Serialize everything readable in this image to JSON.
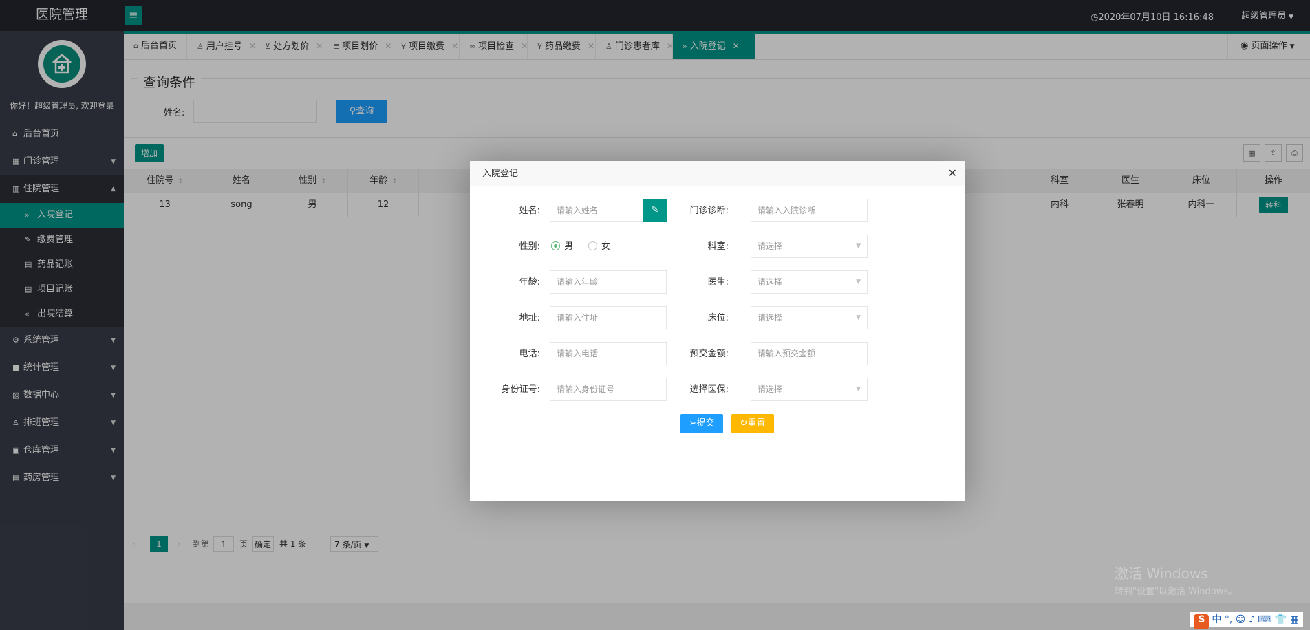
{
  "app": {
    "title": "医院管理",
    "menu_toggle_icon": "≡",
    "datetime": "2020年07月10日 16:16:48",
    "user": "超级管理员"
  },
  "sidebar": {
    "welcome": "你好！超级管理员, 欢迎登录",
    "items_top": [
      {
        "icon": "home-icon",
        "label": "后台首页"
      },
      {
        "icon": "grid-icon",
        "label": "门诊管理"
      },
      {
        "icon": "building-icon",
        "label": "住院管理"
      }
    ],
    "sub_items": [
      {
        "icon": "double-chevron-right-icon",
        "label": "入院登记",
        "active": true
      },
      {
        "icon": "edit-doc-icon",
        "label": "缴费管理"
      },
      {
        "icon": "book-icon",
        "label": "药品记账"
      },
      {
        "icon": "book-icon",
        "label": "项目记账"
      },
      {
        "icon": "double-chevron-left-icon",
        "label": "出院结算"
      }
    ],
    "items_bottom": [
      {
        "icon": "gear-icon",
        "label": "系统管理"
      },
      {
        "icon": "chat-icon",
        "label": "统计管理"
      },
      {
        "icon": "doc-icon",
        "label": "数据中心"
      },
      {
        "icon": "user-icon",
        "label": "排班管理"
      },
      {
        "icon": "boxes-icon",
        "label": "仓库管理"
      },
      {
        "icon": "book-icon",
        "label": "药房管理"
      }
    ]
  },
  "tabs": [
    {
      "label": "后台首页",
      "icon": "home-icon",
      "closable": false
    },
    {
      "label": "用户挂号",
      "icon": "users-icon",
      "closable": true
    },
    {
      "label": "处方划价",
      "icon": "cart-icon",
      "closable": true
    },
    {
      "label": "项目划价",
      "icon": "list-icon",
      "closable": true
    },
    {
      "label": "项目缴费",
      "icon": "yen-icon",
      "closable": true
    },
    {
      "label": "项目检查",
      "icon": "link-icon",
      "closable": true
    },
    {
      "label": "药品缴费",
      "icon": "yen-icon",
      "closable": true
    },
    {
      "label": "门诊患者库",
      "icon": "user-icon",
      "closable": true
    },
    {
      "label": "入院登记",
      "icon": "double-chevron-right-icon",
      "closable": true,
      "active": true
    }
  ],
  "page_ops": "页面操作",
  "search": {
    "legend": "查询条件",
    "name_label": "姓名:",
    "button": "查询"
  },
  "toolbar": {
    "add": "增加"
  },
  "table": {
    "columns": [
      "住院号",
      "姓名",
      "性别",
      "年龄",
      "",
      "科室",
      "医生",
      "床位",
      "操作"
    ],
    "rows": [
      {
        "id": "13",
        "name": "song",
        "gender": "男",
        "age": "12",
        "dept": "内科",
        "doctor": "张春明",
        "bed": "内科一",
        "action": "转科"
      }
    ]
  },
  "pager": {
    "page": "1",
    "goto": "到第",
    "goto_value": "1",
    "page_unit": "页",
    "confirm": "确定",
    "total": "共 1 条",
    "page_size": "7 条/页"
  },
  "watermark": {
    "title": "激活 Windows",
    "subtitle": "转到\"设置\"以激活 Windows。"
  },
  "taskbar": {
    "ime": "中"
  },
  "modal": {
    "title": "入院登记",
    "fields": {
      "name_label": "姓名:",
      "name_placeholder": "请输入姓名",
      "diag_label": "门诊诊断:",
      "diag_placeholder": "请输入入院诊断",
      "gender_label": "性别:",
      "gender_male": "男",
      "gender_female": "女",
      "dept_label": "科室:",
      "dept_placeholder": "请选择",
      "age_label": "年龄:",
      "age_placeholder": "请输入年龄",
      "doctor_label": "医生:",
      "doctor_placeholder": "请选择",
      "addr_label": "地址:",
      "addr_placeholder": "请输入住址",
      "bed_label": "床位:",
      "bed_placeholder": "请选择",
      "phone_label": "电话:",
      "phone_placeholder": "请输入电话",
      "deposit_label": "预交金额:",
      "deposit_placeholder": "请输入预交金额",
      "idcard_label": "身份证号:",
      "idcard_placeholder": "请输入身份证号",
      "insurance_label": "选择医保:",
      "insurance_placeholder": "请选择"
    },
    "submit": "提交",
    "reset": "重置"
  },
  "colors": {
    "accent": "#009688",
    "topbar": "#23262e",
    "sidebar": "#393d49",
    "primary": "#1E9FFF",
    "warn": "#FFB800"
  }
}
